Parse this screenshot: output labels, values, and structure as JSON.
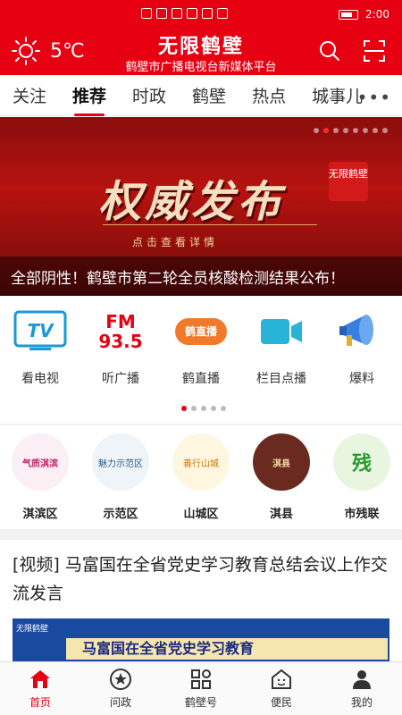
{
  "status_bar": {
    "time": "2:00"
  },
  "header": {
    "temperature": "5℃",
    "app_title": "无限鹤壁",
    "app_subtitle": "鹤壁市广播电视台新媒体平台",
    "accent_color": "#e60012"
  },
  "tabs": [
    {
      "label": "关注",
      "active": false
    },
    {
      "label": "推荐",
      "active": true
    },
    {
      "label": "时政",
      "active": false
    },
    {
      "label": "鹤壁",
      "active": false
    },
    {
      "label": "热点",
      "active": false
    },
    {
      "label": "城事儿",
      "active": false
    }
  ],
  "more_label": "•••",
  "banner": {
    "headline_art": "权威发布",
    "stamp": "无限鹤壁",
    "hint": "点击查看详情",
    "caption": "全部阴性！鹤壁市第二轮全员核酸检测结果公布！",
    "page_count": 8,
    "current_page": 2
  },
  "quick_actions": [
    {
      "label": "看电视",
      "icon": "tv-icon",
      "icon_text": "TV"
    },
    {
      "label": "听广播",
      "icon": "radio-icon",
      "icon_text": "FM 93.5"
    },
    {
      "label": "鹤直播",
      "icon": "live-icon",
      "icon_text": "鹤直播"
    },
    {
      "label": "栏目点播",
      "icon": "video-icon"
    },
    {
      "label": "爆料",
      "icon": "megaphone-icon"
    }
  ],
  "quick_pager": {
    "pages": 5,
    "current": 1
  },
  "districts": [
    {
      "label": "淇滨区",
      "logo_text": "气质淇滨"
    },
    {
      "label": "示范区",
      "logo_text": "魅力示范区"
    },
    {
      "label": "山城区",
      "logo_text": "善行山城"
    },
    {
      "label": "淇县",
      "logo_text": "淇县"
    },
    {
      "label": "市残联",
      "logo_text": "残"
    }
  ],
  "news": {
    "headline": "[视频] 马富国在全省党史学习教育总结会议上作交流发言",
    "thumb_text": "马富国在全省党史学习教育",
    "thumb_logo": "无限鹤壁"
  },
  "bottom_nav": [
    {
      "label": "首页",
      "icon": "home-icon",
      "active": true
    },
    {
      "label": "问政",
      "icon": "question-star-icon",
      "active": false
    },
    {
      "label": "鹤壁号",
      "icon": "grid-icon",
      "active": false
    },
    {
      "label": "便民",
      "icon": "smile-house-icon",
      "active": false
    },
    {
      "label": "我的",
      "icon": "user-icon",
      "active": false
    }
  ]
}
